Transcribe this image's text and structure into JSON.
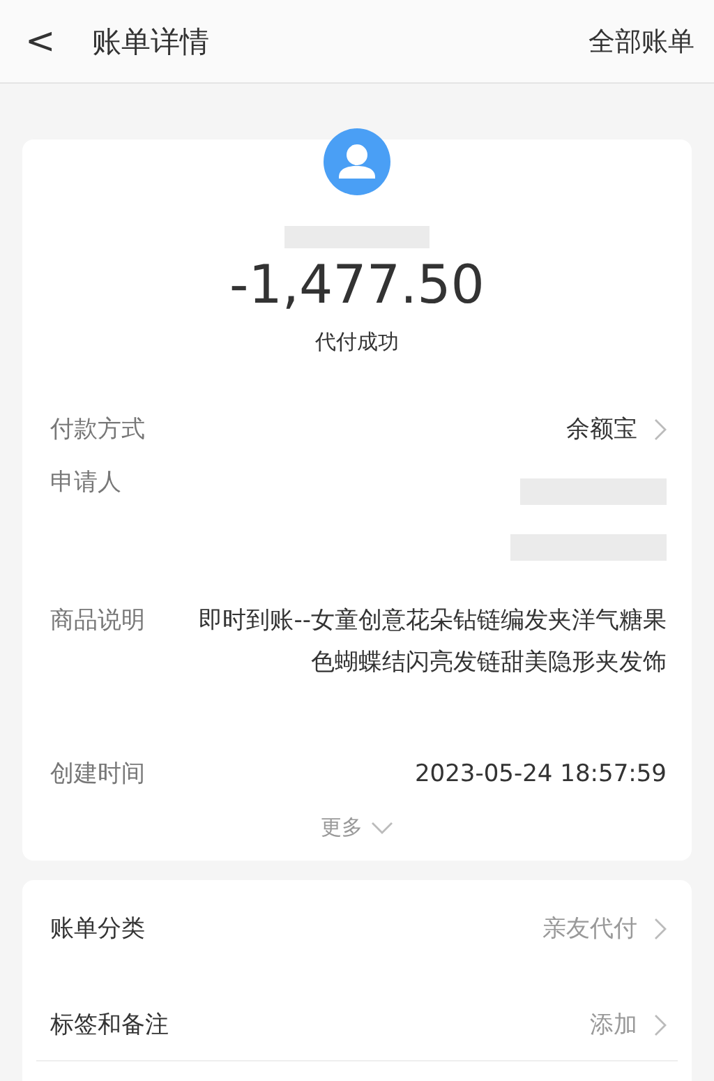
{
  "header": {
    "back_icon": "<",
    "title": "账单详情",
    "action": "全部账单"
  },
  "summary": {
    "amount": "-1,477.50",
    "status": "代付成功"
  },
  "details": [
    {
      "kind": "link",
      "label": "付款方式",
      "value": "余额宝"
    },
    {
      "kind": "redacted",
      "label": "申请人"
    },
    {
      "kind": "text",
      "label": "商品说明",
      "value": "即时到账--女童创意花朵钻链编发夹洋气糖果色蝴蝶结闪亮发链甜美隐形夹发饰"
    },
    {
      "kind": "text",
      "label": "创建时间",
      "value": "2023-05-24 18:57:59"
    }
  ],
  "more": "更多",
  "extras": [
    {
      "label": "账单分类",
      "value": "亲友代付"
    },
    {
      "label": "标签和备注",
      "value": "添加"
    }
  ]
}
